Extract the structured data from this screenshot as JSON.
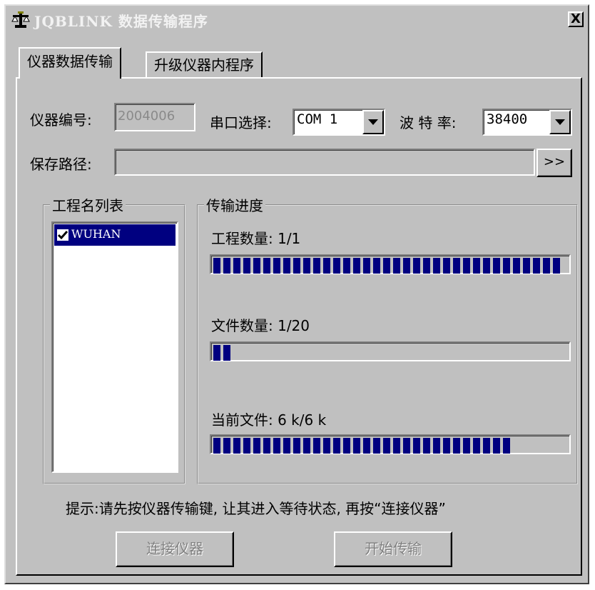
{
  "window": {
    "title": "JQBLINK 数据传输程序",
    "close_glyph": "X",
    "app_icon": "scale-balance-icon"
  },
  "tabs": [
    {
      "label": "仪器数据传输",
      "active": true
    },
    {
      "label": "升级仪器内程序",
      "active": false
    }
  ],
  "form": {
    "instrument_no": {
      "label": "仪器编号:",
      "value": "2004006"
    },
    "serial_port": {
      "label": "串口选择:",
      "value": "COM 1"
    },
    "baud_rate": {
      "label": "波 特 率:",
      "value": "38400"
    },
    "save_path": {
      "label": "保存路径:",
      "value": "",
      "browse_label": ">>"
    }
  },
  "project_list": {
    "title": "工程名列表",
    "items": [
      {
        "label": "WUHAN",
        "checked": true,
        "selected": true
      }
    ]
  },
  "progress": {
    "title": "传输进度",
    "projects": {
      "label": "工程数量: 1/1",
      "fraction": 1.0
    },
    "files": {
      "label": "文件数量: 1/20",
      "fraction": 0.05
    },
    "current_file": {
      "label": "当前文件: 6 k/6 k",
      "fraction": 0.86
    }
  },
  "hint": "提示:请先按仪器传输键, 让其进入等待状态, 再按“连接仪器”",
  "buttons": {
    "connect": {
      "label": "连接仪器",
      "enabled": false
    },
    "start": {
      "label": "开始传输",
      "enabled": false
    }
  },
  "colors": {
    "face": "#c0c0c0",
    "selection": "#000080",
    "progress_block": "#000080",
    "disabled_text": "#808080"
  }
}
